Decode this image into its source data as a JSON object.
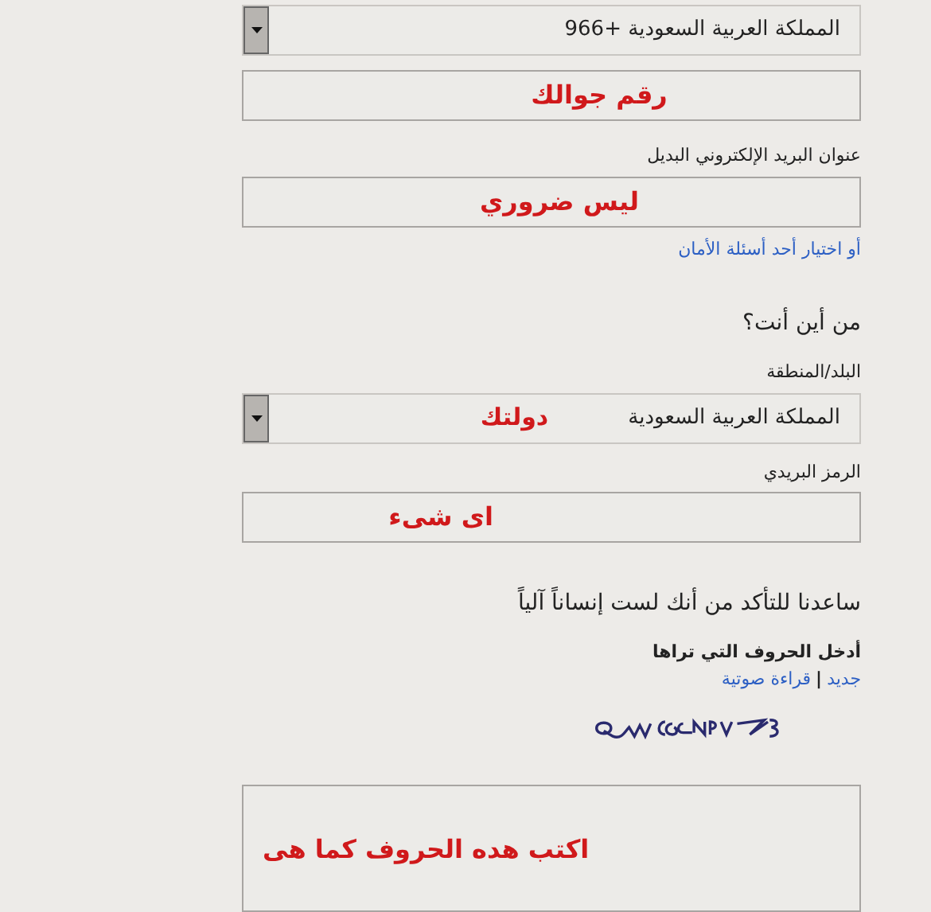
{
  "phone": {
    "country_select": {
      "value": "المملكة العربية السعودية +966"
    },
    "number_field": {
      "note": "رقم جوالك"
    }
  },
  "alternate_email": {
    "label": "عنوان البريد الإلكتروني البديل",
    "note": "ليس ضروري",
    "link": "أو اختيار أحد أسئلة الأمان"
  },
  "location": {
    "heading": "من أين أنت؟",
    "region_label": "البلد/المنطقة",
    "region_select": {
      "value": "المملكة العربية السعودية",
      "note": "دولتك"
    },
    "postal_label": "الرمز البريدي",
    "postal_note": "اى شىء"
  },
  "captcha": {
    "heading": "ساعدنا للتأكد من أنك لست إنساناً آلياً",
    "instruction": "أدخل الحروف التي تراها",
    "links": [
      "جديد",
      "قراءة صوتية"
    ],
    "separator": "|",
    "note": "اكتب هده الحروف كما هى"
  }
}
